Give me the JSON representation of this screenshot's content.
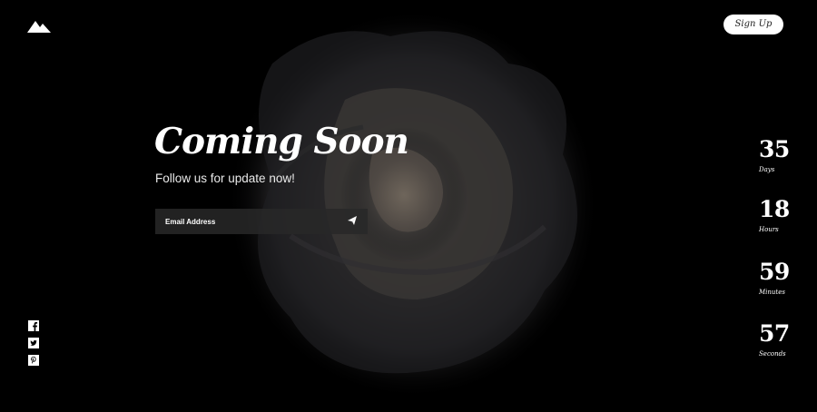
{
  "header": {
    "logo_icon": "mountain-icon",
    "signup_label": "Sign Up"
  },
  "hero": {
    "title": "Coming Soon",
    "subtitle": "Follow us for update now!"
  },
  "subscribe": {
    "email_placeholder": "Email Address",
    "send_icon": "paper-plane-icon"
  },
  "countdown": [
    {
      "value": "35",
      "label": "Days"
    },
    {
      "value": "18",
      "label": "Hours"
    },
    {
      "value": "59",
      "label": "Minutes"
    },
    {
      "value": "57",
      "label": "Seconds"
    }
  ],
  "social": [
    {
      "icon": "facebook-icon"
    },
    {
      "icon": "twitter-icon"
    },
    {
      "icon": "pinterest-icon"
    }
  ],
  "colors": {
    "background": "#000000",
    "text": "#ffffff",
    "button_bg": "#ffffff",
    "input_bg": "#282828"
  }
}
